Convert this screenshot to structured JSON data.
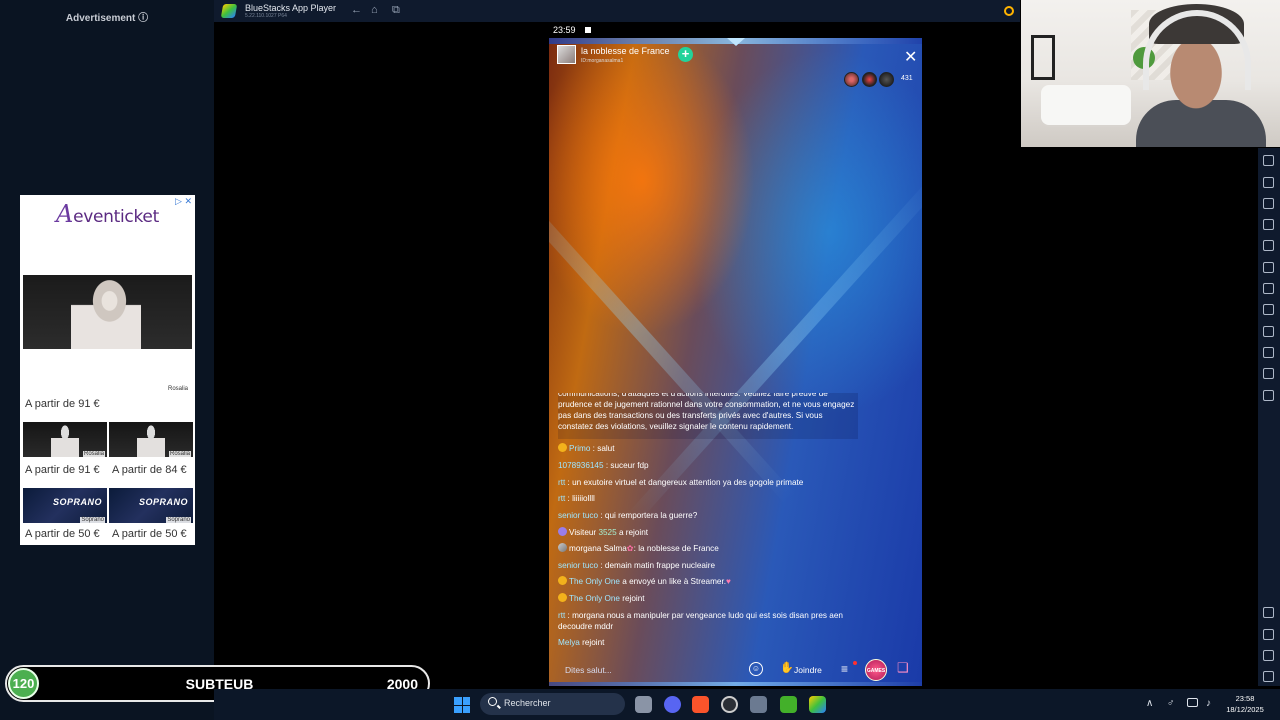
{
  "ad": {
    "header": "Advertisement ⓘ",
    "close": "▷ ✕",
    "logo_a": "A",
    "logo_rest": "eventicket",
    "hero_caption": "Rosalia",
    "hero_price": "A partir de 91 €",
    "items": [
      {
        "caption": "Rosalia",
        "price": "A partir de 91 €"
      },
      {
        "caption": "Rosalia",
        "price": "A partir de 84 €"
      },
      {
        "caption": "Soprano",
        "price": "A partir de 50 €",
        "title": "SOPRANO"
      },
      {
        "caption": "Soprano",
        "price": "A partir de 50 €",
        "title": "SOPRANO"
      }
    ]
  },
  "bluestacks": {
    "title": "BlueStacks App Player",
    "subtitle": "5.22.110.1027 P64",
    "back": "←",
    "home": "⌂",
    "tabs": "⧉"
  },
  "phone": {
    "time": "23:59",
    "host_name": "la noblesse de France",
    "host_id": "ID:morganasalma1",
    "follow": "+",
    "close": "✕",
    "viewer_count": "431",
    "notice": "communications, d'attaques et d'actions interdites. Veuillez faire preuve de prudence et de jugement rationnel dans votre consommation, et ne vous engagez pas dans des transactions ou des transferts privés avec d'autres. Si vous constatez des violations, veuillez signaler le contenu rapidement.",
    "messages": [
      {
        "user": "Primo",
        "sep": " : ",
        "text": "salut"
      },
      {
        "user": "1078936145",
        "sep": " : ",
        "text": "suceur fdp"
      },
      {
        "user": "rtt",
        "sep": " : ",
        "text": "un exutoire virtuel et dangereux attention ya des gogole primate"
      },
      {
        "user": "rtt",
        "sep": " : ",
        "text": "liiiiiollll"
      },
      {
        "user": "senior tuco",
        "sep": " : ",
        "text": "qui remportera la guerre?"
      },
      {
        "user": "Visiteur",
        "num": "3525",
        "text": "a rejoint"
      },
      {
        "user": "morgana Salma",
        "flower": "✿",
        "sep": ": ",
        "text": "la noblesse de France"
      },
      {
        "user": "senior tuco",
        "sep": " : ",
        "text": "demain matin frappe nucleaire"
      },
      {
        "user": "The Only One",
        "text": "a envoyé un like à Streamer.",
        "heart": "♥"
      },
      {
        "user": "The Only One",
        "text": "rejoint"
      },
      {
        "user": "rtt",
        "sep": " : ",
        "text": "morgana nous a manipuler par vengeance ludo qui est sois disan pres aen decoudre mddr"
      },
      {
        "user": "Melya",
        "text": "rejoint"
      }
    ],
    "input_placeholder": "Dites salut...",
    "emoji": "☺",
    "join_icon": "✋",
    "join": "Joindre",
    "menu": "≡",
    "game_label": "GAMES",
    "gift": "❑"
  },
  "score": {
    "level": "120",
    "name": "SUBTEUB",
    "value": "2000"
  },
  "taskbar": {
    "search": "Rechercher",
    "time": "23:58",
    "date": "18/12/2025",
    "tray_chevron": "∧",
    "mic": "♂",
    "speaker": "♪"
  }
}
